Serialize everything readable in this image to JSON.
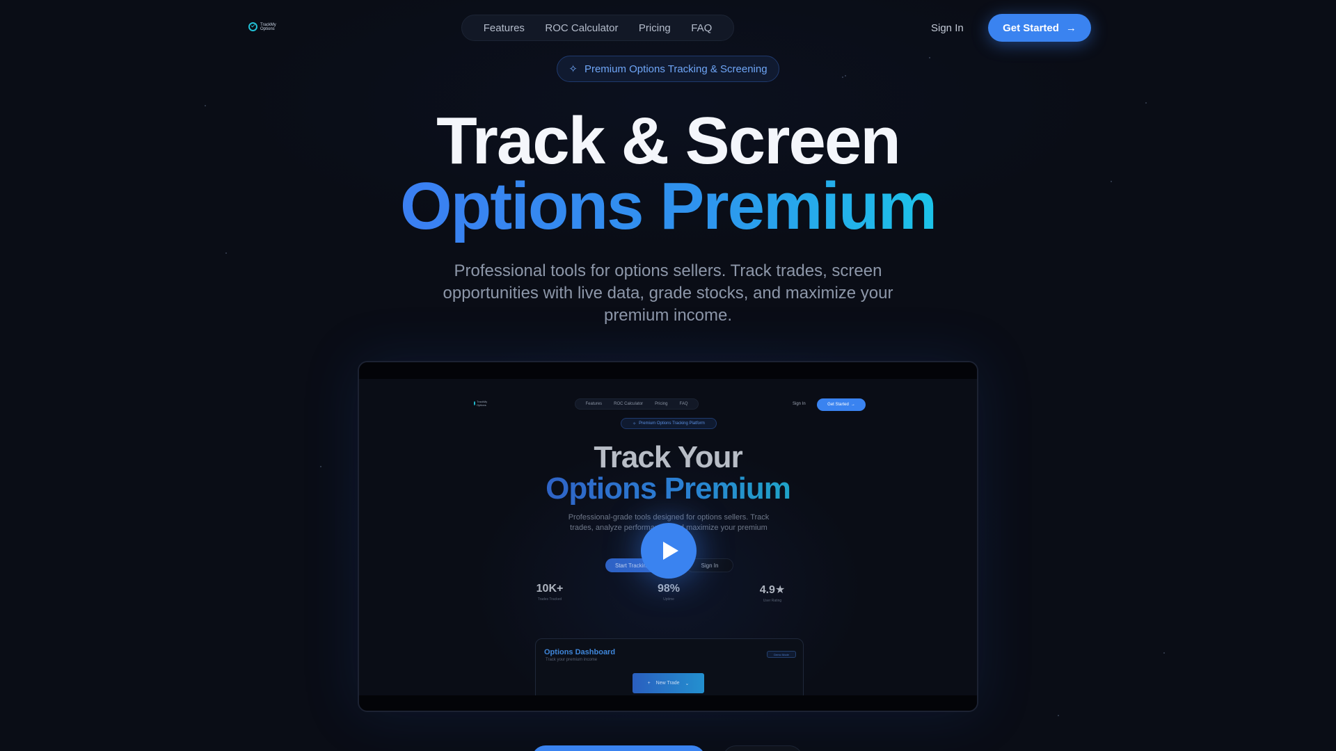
{
  "brand": {
    "logo_text": "TrackMy Options"
  },
  "nav": {
    "links": [
      "Features",
      "ROC Calculator",
      "Pricing",
      "FAQ"
    ],
    "sign_in": "Sign In",
    "cta": "Get Started"
  },
  "badge": {
    "text": "Premium Options Tracking & Screening"
  },
  "hero": {
    "line1": "Track & Screen",
    "line2": "Options Premium",
    "subtitle": "Professional tools for options sellers. Track trades, screen opportunities with live data, grade stocks, and maximize your premium income."
  },
  "preview": {
    "nav_links": [
      "Features",
      "ROC Calculator",
      "Pricing",
      "FAQ"
    ],
    "sign_in": "Sign In",
    "cta": "Get Started",
    "badge": "Premium Options Tracking Platform",
    "line1": "Track Your",
    "line2": "Options Premium",
    "subtitle": "Professional-grade tools designed for options sellers. Track trades, analyze performance, and maximize your premium income.",
    "btn_primary": "Start Tracking",
    "btn_secondary": "Sign In",
    "stats": [
      {
        "value": "10K+",
        "label": "Trades Tracked"
      },
      {
        "value": "98%",
        "label": "Uptime"
      },
      {
        "value": "4.9★",
        "label": "User Rating"
      }
    ],
    "dashboard": {
      "title": "Options Dashboard",
      "subtitle": "Track your premium income",
      "demo_badge": "Demo Mode",
      "new_trade": "New Trade"
    }
  },
  "colors": {
    "accent": "#3a83f0",
    "gradient_end": "#1cc3e8",
    "background": "#0a0d16"
  }
}
